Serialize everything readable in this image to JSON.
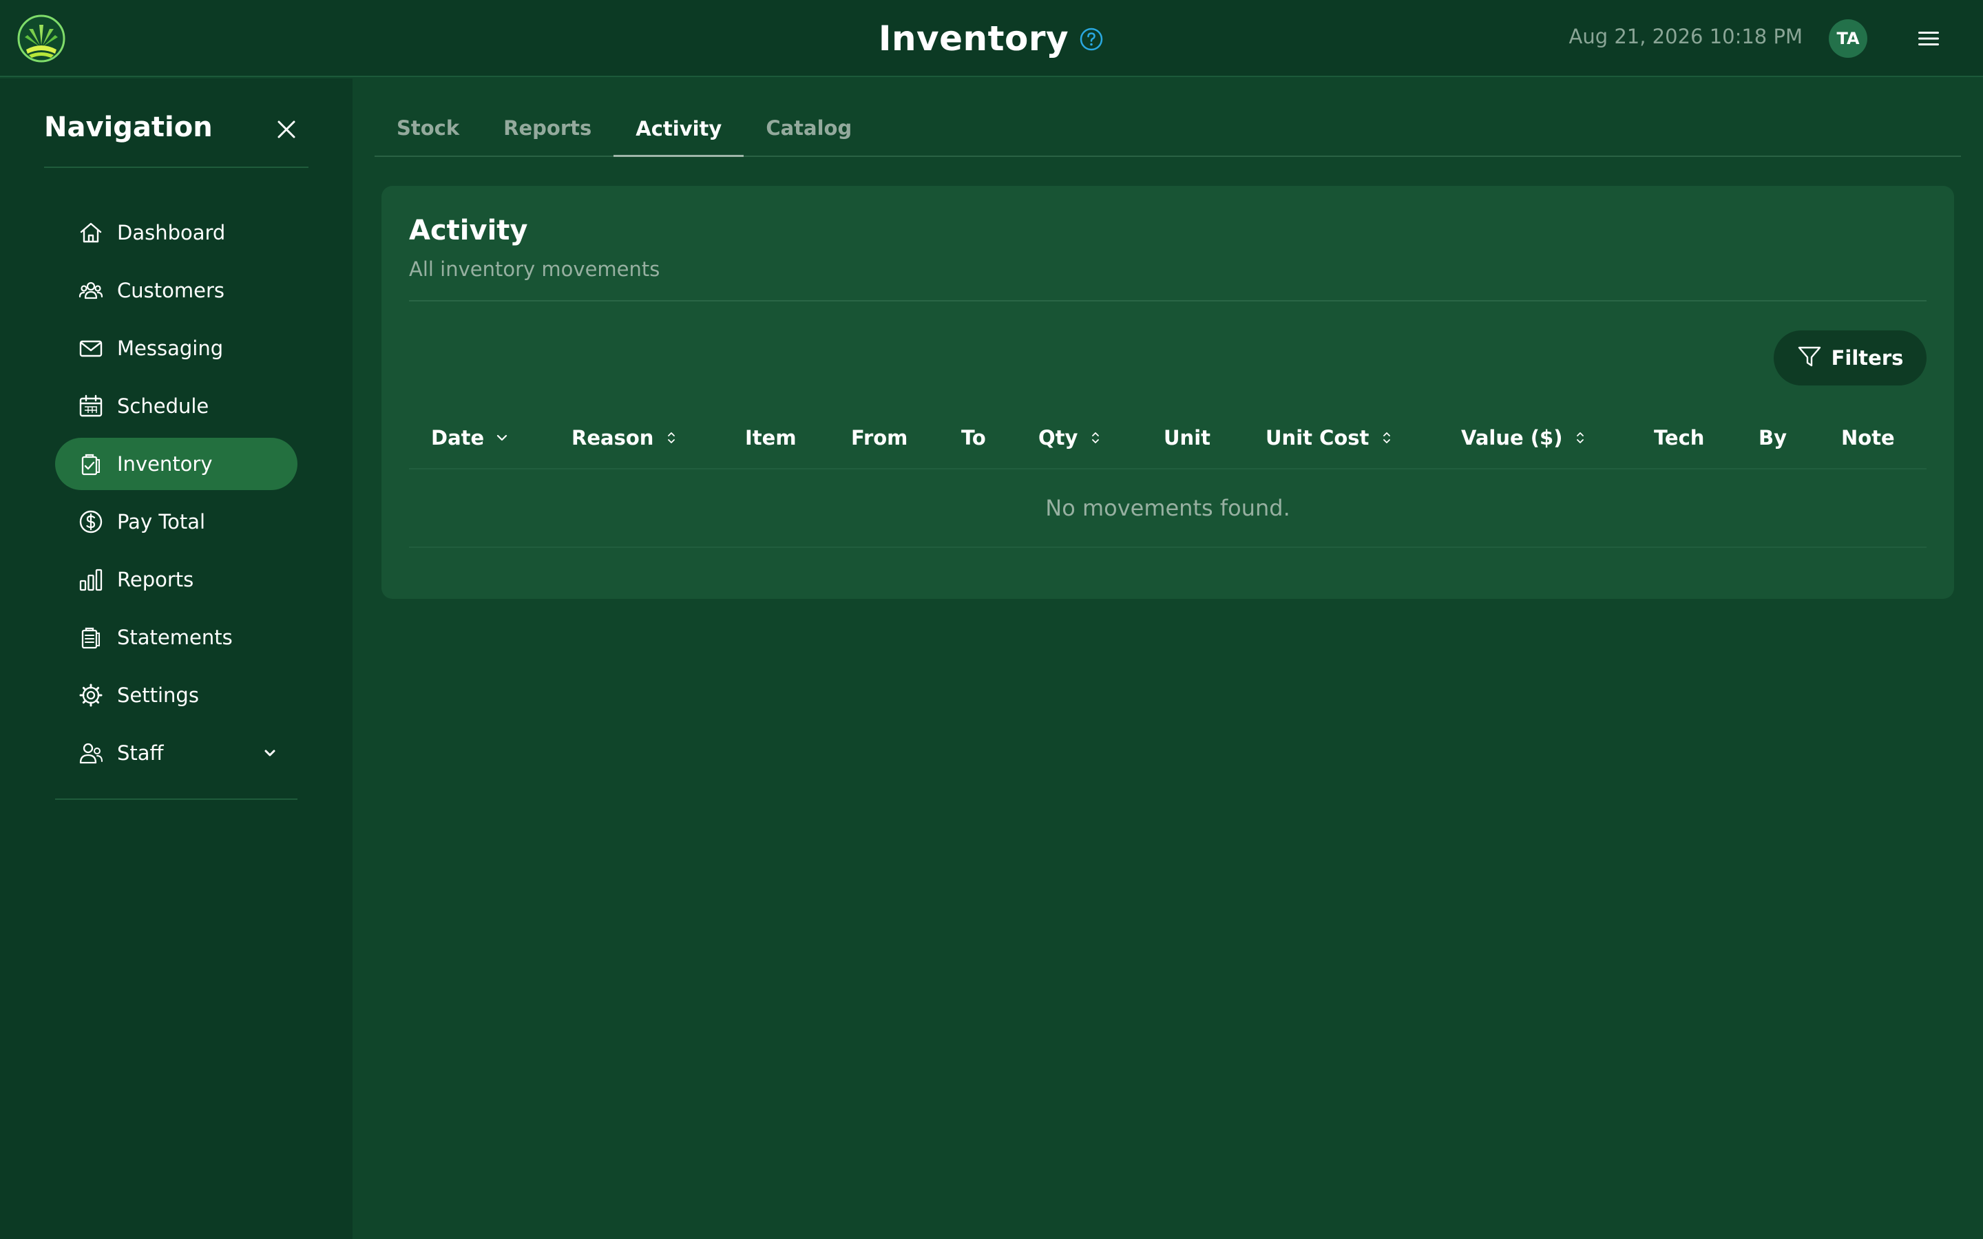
{
  "header": {
    "title": "Inventory",
    "datetime": "Aug 21, 2026 10:18 PM",
    "avatar_initials": "TA",
    "icons": {
      "logo": "grass-logo",
      "help": "help-circle-icon",
      "menu": "hamburger-menu-icon"
    }
  },
  "sidebar": {
    "title": "Navigation",
    "items": [
      {
        "label": "Dashboard",
        "icon": "home-icon",
        "active": false
      },
      {
        "label": "Customers",
        "icon": "users-group-icon",
        "active": false
      },
      {
        "label": "Messaging",
        "icon": "mail-icon",
        "active": false
      },
      {
        "label": "Schedule",
        "icon": "calendar-icon",
        "active": false
      },
      {
        "label": "Inventory",
        "icon": "clipboard-check-icon",
        "active": true
      },
      {
        "label": "Pay Total",
        "icon": "dollar-circle-icon",
        "active": false
      },
      {
        "label": "Reports",
        "icon": "bar-chart-icon",
        "active": false
      },
      {
        "label": "Statements",
        "icon": "document-list-icon",
        "active": false
      },
      {
        "label": "Settings",
        "icon": "gear-icon",
        "active": false
      },
      {
        "label": "Staff",
        "icon": "user-staff-icon",
        "active": false,
        "expandable": true
      }
    ]
  },
  "tabs": [
    {
      "label": "Stock",
      "active": false
    },
    {
      "label": "Reports",
      "active": false
    },
    {
      "label": "Activity",
      "active": true
    },
    {
      "label": "Catalog",
      "active": false
    }
  ],
  "activity": {
    "title": "Activity",
    "subtitle": "All inventory movements",
    "filters_label": "Filters",
    "columns": [
      {
        "label": "Date",
        "sort": "desc"
      },
      {
        "label": "Reason",
        "sort": "sortable"
      },
      {
        "label": "Item",
        "sort": "none"
      },
      {
        "label": "From",
        "sort": "none"
      },
      {
        "label": "To",
        "sort": "none"
      },
      {
        "label": "Qty",
        "sort": "sortable"
      },
      {
        "label": "Unit",
        "sort": "none"
      },
      {
        "label": "Unit Cost",
        "sort": "sortable"
      },
      {
        "label": "Value ($)",
        "sort": "sortable"
      },
      {
        "label": "Tech",
        "sort": "none"
      },
      {
        "label": "By",
        "sort": "none"
      },
      {
        "label": "Note",
        "sort": "none"
      }
    ],
    "rows": [],
    "empty_message": "No movements found."
  },
  "colors": {
    "background": "#10452a",
    "sidebar": "#0c3a24",
    "card": "#185434",
    "active_nav": "#23703f",
    "help_accent": "#2aa8e0",
    "muted_text": "#97b0a1"
  }
}
